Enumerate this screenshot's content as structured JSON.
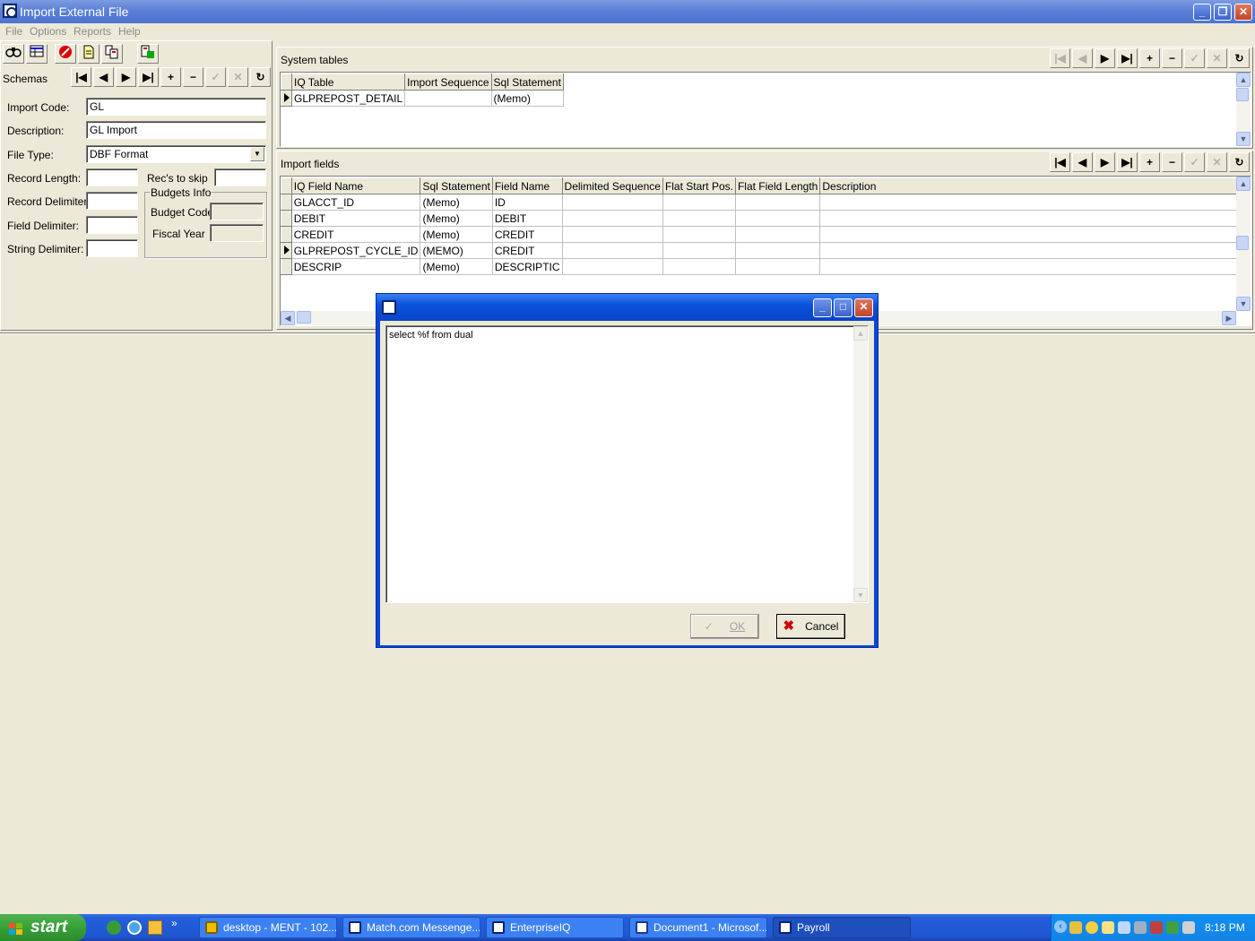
{
  "window": {
    "title": "Import External File"
  },
  "menu": [
    "File",
    "Options",
    "Reports",
    "Help"
  ],
  "toolbar": {
    "icons": [
      "binoculars-icon",
      "table-view-icon",
      "stop-icon",
      "document-icon",
      "copy-icon",
      "export-icon"
    ]
  },
  "schemas": {
    "label": "Schemas",
    "nav": [
      "|◀",
      "◀",
      "▶",
      "▶|",
      "+",
      "−",
      "✓",
      "✕",
      "↻"
    ]
  },
  "form": {
    "import_code_label": "Import Code:",
    "import_code_value": "GL",
    "description_label": "Description:",
    "description_value": "GL Import",
    "file_type_label": "File Type:",
    "file_type_value": "DBF Format",
    "record_length_label": "Record Length:",
    "recs_to_skip_label": "Rec's to skip",
    "record_delimiters_label": "Record Delimiters:",
    "field_delimiter_label": "Field Delimiter:",
    "string_delimiter_label": "String Delimiter:",
    "budgets_info_label": "Budgets Info",
    "budget_code_label": "Budget Code",
    "fiscal_year_label": "Fiscal Year"
  },
  "system_tables": {
    "label": "System tables",
    "columns": [
      "IQ Table",
      "Import Sequence",
      "Sql Statement"
    ],
    "rows": [
      [
        "GLPREPOST_DETAIL",
        "",
        "(Memo)"
      ]
    ]
  },
  "import_fields": {
    "label": "Import fields",
    "columns": [
      "IQ Field Name",
      "Sql Statement",
      "Field Name",
      "Delimited Sequence",
      "Flat Start Pos.",
      "Flat Field Length",
      "Description"
    ],
    "rows": [
      [
        "GLACCT_ID",
        "(Memo)",
        "ID",
        "",
        "",
        "",
        ""
      ],
      [
        "DEBIT",
        "(Memo)",
        "DEBIT",
        "",
        "",
        "",
        ""
      ],
      [
        "CREDIT",
        "(Memo)",
        "CREDIT",
        "",
        "",
        "",
        ""
      ],
      [
        "GLPREPOST_CYCLE_ID",
        "(MEMO)",
        "CREDIT",
        "",
        "",
        "",
        ""
      ],
      [
        "DESCRIP",
        "(Memo)",
        "DESCRIPTIC",
        "",
        "",
        "",
        ""
      ]
    ]
  },
  "dialog": {
    "sql_text": "select %f from dual",
    "ok_label": "OK",
    "cancel_label": "Cancel"
  },
  "taskbar": {
    "start_label": "start",
    "tasks": [
      "desktop - MENT - 102...",
      "Match.com Messenge...",
      "EnterpriseIQ",
      "Document1 - Microsof...",
      "Payroll"
    ],
    "clock": "8:18 PM"
  }
}
